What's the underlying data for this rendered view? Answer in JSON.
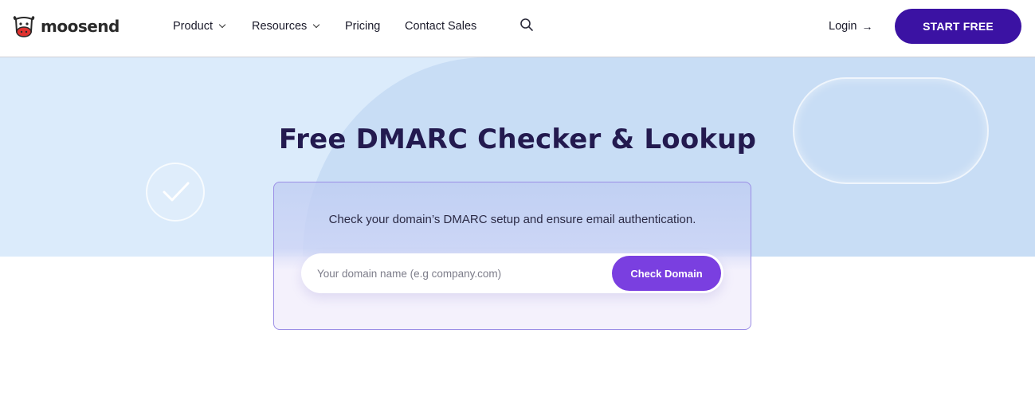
{
  "brand": {
    "name": "moosend"
  },
  "nav": {
    "items": [
      {
        "label": "Product",
        "has_dropdown": true
      },
      {
        "label": "Resources",
        "has_dropdown": true
      },
      {
        "label": "Pricing",
        "has_dropdown": false
      },
      {
        "label": "Contact Sales",
        "has_dropdown": false
      }
    ],
    "search_icon": "search-icon",
    "login_label": "Login",
    "login_arrow": "→",
    "cta_label": "START FREE"
  },
  "hero": {
    "title": "Free DMARC Checker & Lookup"
  },
  "checker": {
    "description": "Check your domain’s DMARC setup and ensure email authentication.",
    "input_value": "",
    "input_placeholder": "Your domain name (e.g company.com)",
    "button_label": "Check Domain"
  },
  "colors": {
    "primary_dark": "#3b12a3",
    "button_purple": "#7a3fe0",
    "hero_bg": "#dbebfb",
    "title": "#231a4f"
  }
}
